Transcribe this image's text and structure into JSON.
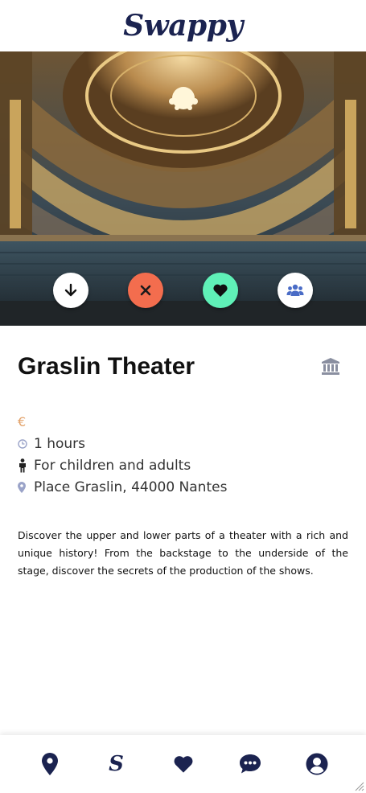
{
  "app": {
    "brand": "Swappy"
  },
  "hero": {
    "image_description_icon": "theater-photo",
    "actions": [
      {
        "name": "download-icon",
        "color": "#ffffff"
      },
      {
        "name": "close-icon",
        "color": "#f36d4e"
      },
      {
        "name": "heart-icon",
        "color": "#5ff0b7"
      },
      {
        "name": "group-icon",
        "color": "#ffffff"
      }
    ]
  },
  "activity": {
    "title": "Graslin Theater",
    "category_icon": "museum-icon",
    "price": "€",
    "duration": "1 hours",
    "audience": "For children and adults",
    "address": "Place Graslin, 44000 Nantes",
    "description": "Discover the upper and lower parts of a theater with a rich and unique history! From the backstage to the underside of the stage, discover the secrets of the production of the shows."
  },
  "nav": {
    "items": [
      {
        "name": "map-pin-icon"
      },
      {
        "name": "swappy-s-icon",
        "label": "S"
      },
      {
        "name": "heart-icon"
      },
      {
        "name": "chat-icon"
      },
      {
        "name": "profile-icon"
      }
    ]
  },
  "colors": {
    "brand": "#1b2350",
    "accent_price": "#e3a36b",
    "close": "#f36d4e",
    "like": "#5ff0b7",
    "icon_muted": "#9aa3c8"
  }
}
